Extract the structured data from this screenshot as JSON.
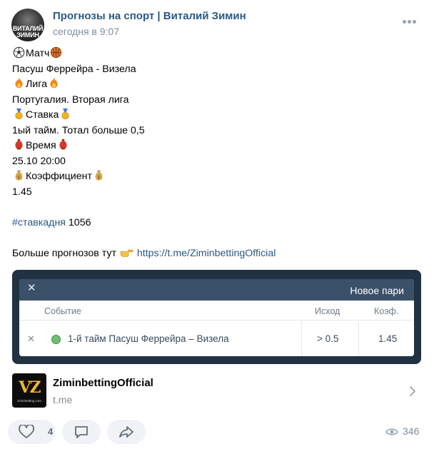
{
  "post": {
    "author": "Прогнозы на спорт | Виталий Зимин",
    "time": "сегодня в 9:07",
    "avatar_text_1": "ВИТАЛИЙ",
    "avatar_text_2": "ЗИМИН"
  },
  "body": {
    "match_label": "Матч",
    "match_value": "Пасуш Феррейра - Визела",
    "league_label": "Лига",
    "league_value": "Португалия. Вторая лига",
    "bet_label": "Ставка",
    "bet_value": "1ый тайм. Тотал больше 0,5",
    "time_label": "Время",
    "time_value": "25.10 20:00",
    "coef_label": "Коэффициент",
    "coef_value": "1.45",
    "hashtag": "#ставкадня",
    "hashtag_number": "1056",
    "more_text": "Больше прогнозов тут",
    "more_link": "https://t.me/ZiminbettingOfficial"
  },
  "snippet": {
    "title": "Новое пари",
    "col_event": "Событие",
    "col_outcome": "Исход",
    "col_coef": "Коэф.",
    "row_event": "1-й тайм Пасуш Феррейра – Визела",
    "row_outcome": "> 0.5",
    "row_coef": "1.45"
  },
  "link_preview": {
    "title": "ZiminbettingOfficial",
    "domain": "t.me",
    "logo_text": "VZ",
    "logo_small_text": "ziminbetting.com"
  },
  "actions": {
    "likes": "4",
    "views": "346"
  },
  "colors": {
    "link": "#2a5885",
    "muted": "#818c99",
    "snippet_bg": "#213243",
    "snippet_header": "#3b5169"
  }
}
